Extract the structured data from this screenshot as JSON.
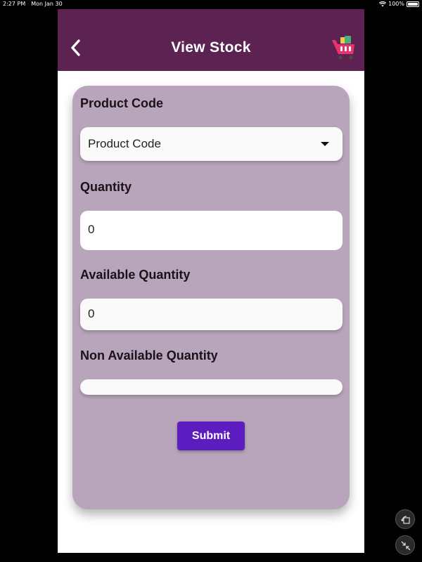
{
  "status_bar": {
    "time": "2:27 PM",
    "date": "Mon Jan 30",
    "battery": "100%",
    "wifi_icon": "wifi-icon",
    "battery_icon": "battery-icon"
  },
  "app_bar": {
    "title": "View Stock",
    "back_icon": "chevron-left-icon",
    "cart_icon": "shopping-cart-icon",
    "background_color": "#5c2352"
  },
  "form": {
    "background_color": "#b9a5bb",
    "product_code": {
      "label": "Product Code",
      "selected_value": "Product Code"
    },
    "quantity": {
      "label": "Quantity",
      "value": "0"
    },
    "available_quantity": {
      "label": "Available Quantity",
      "value": "0"
    },
    "non_available_quantity": {
      "label": "Non Available Quantity",
      "value": ""
    },
    "submit_label": "Submit",
    "submit_color": "#5c1dc0"
  },
  "floating_controls": {
    "rotate_icon": "rotate-icon",
    "collapse_icon": "collapse-icon"
  }
}
